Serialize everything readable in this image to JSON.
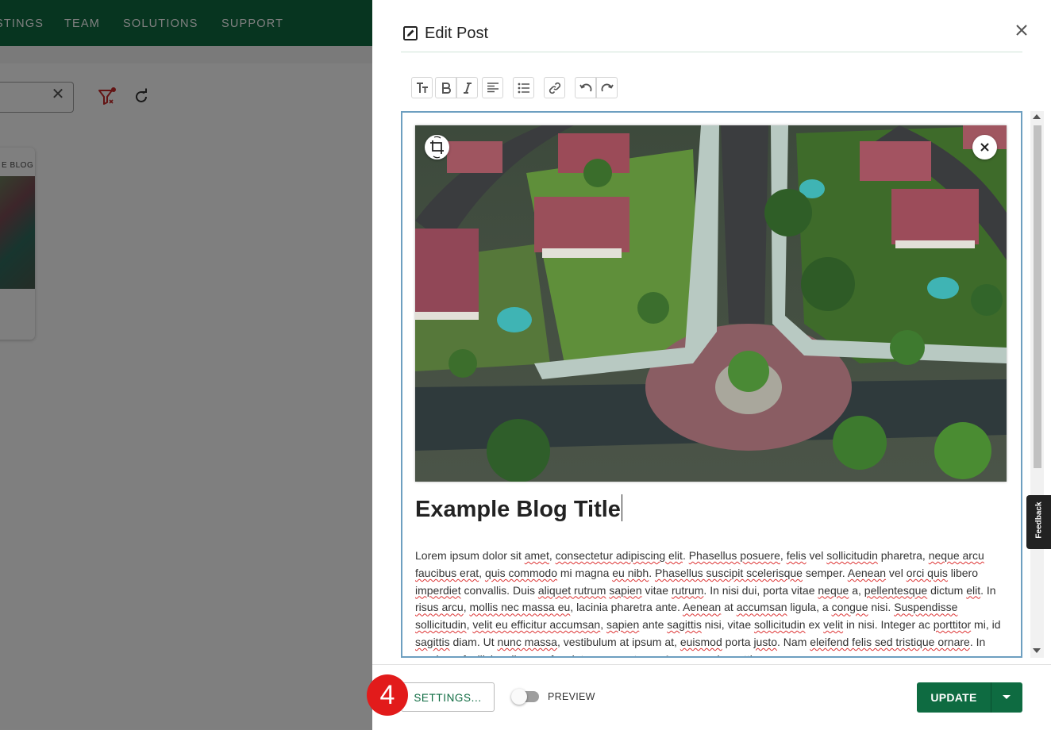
{
  "background_page": {
    "nav_items": [
      "STINGS",
      "TEAM",
      "SOLUTIONS",
      "SUPPORT"
    ],
    "post_card_label": "E BLOG"
  },
  "drawer": {
    "title": "Edit Post",
    "toolbar": {
      "icons": [
        "text-size-icon",
        "bold-icon",
        "italic-icon",
        "align-left-icon",
        "bullet-list-icon",
        "link-icon",
        "undo-icon",
        "redo-icon"
      ]
    },
    "post": {
      "title": "Example Blog Title",
      "body_segments": [
        {
          "t": "Lorem ipsum dolor sit ",
          "sp": false
        },
        {
          "t": "amet",
          "sp": true
        },
        {
          "t": ", ",
          "sp": false
        },
        {
          "t": "consectetur adipiscing elit",
          "sp": true
        },
        {
          "t": ". ",
          "sp": false
        },
        {
          "t": "Phasellus posuere",
          "sp": true
        },
        {
          "t": ", ",
          "sp": false
        },
        {
          "t": "felis",
          "sp": true
        },
        {
          "t": " vel ",
          "sp": false
        },
        {
          "t": "sollicitudin",
          "sp": true
        },
        {
          "t": " pharetra, ",
          "sp": false
        },
        {
          "t": "neque arcu faucibus erat",
          "sp": true
        },
        {
          "t": ", ",
          "sp": false
        },
        {
          "t": "quis commodo",
          "sp": true
        },
        {
          "t": " mi magna ",
          "sp": false
        },
        {
          "t": "eu nibh",
          "sp": true
        },
        {
          "t": ". ",
          "sp": false
        },
        {
          "t": "Phasellus suscipit scelerisque",
          "sp": true
        },
        {
          "t": " semper. ",
          "sp": false
        },
        {
          "t": "Aenean",
          "sp": true
        },
        {
          "t": " vel ",
          "sp": false
        },
        {
          "t": "orci quis",
          "sp": true
        },
        {
          "t": " libero ",
          "sp": false
        },
        {
          "t": "imperdiet",
          "sp": true
        },
        {
          "t": " convallis. Duis ",
          "sp": false
        },
        {
          "t": "aliquet rutrum",
          "sp": true
        },
        {
          "t": " ",
          "sp": false
        },
        {
          "t": "sapien",
          "sp": true
        },
        {
          "t": " vitae ",
          "sp": false
        },
        {
          "t": "rutrum",
          "sp": true
        },
        {
          "t": ". In nisi dui, porta vitae ",
          "sp": false
        },
        {
          "t": "neque",
          "sp": true
        },
        {
          "t": " a, ",
          "sp": false
        },
        {
          "t": "pellentesque",
          "sp": true
        },
        {
          "t": " dictum ",
          "sp": false
        },
        {
          "t": "elit",
          "sp": true
        },
        {
          "t": ". In ",
          "sp": false
        },
        {
          "t": "risus arcu",
          "sp": true
        },
        {
          "t": ", ",
          "sp": false
        },
        {
          "t": "mollis nec massa eu",
          "sp": true
        },
        {
          "t": ", lacinia pharetra ante. ",
          "sp": false
        },
        {
          "t": "Aenean",
          "sp": true
        },
        {
          "t": " at ",
          "sp": false
        },
        {
          "t": "accumsan",
          "sp": true
        },
        {
          "t": " ligula, a ",
          "sp": false
        },
        {
          "t": "congue",
          "sp": true
        },
        {
          "t": " nisi. ",
          "sp": false
        },
        {
          "t": "Suspendisse sollicitudin",
          "sp": true
        },
        {
          "t": ", ",
          "sp": false
        },
        {
          "t": "velit eu efficitur accumsan",
          "sp": true
        },
        {
          "t": ", ",
          "sp": false
        },
        {
          "t": "sapien",
          "sp": true
        },
        {
          "t": " ante ",
          "sp": false
        },
        {
          "t": "sagittis",
          "sp": true
        },
        {
          "t": " nisi, vitae ",
          "sp": false
        },
        {
          "t": "sollicitudin",
          "sp": true
        },
        {
          "t": " ex ",
          "sp": false
        },
        {
          "t": "velit",
          "sp": true
        },
        {
          "t": " in nisi. Integer ac ",
          "sp": false
        },
        {
          "t": "porttitor",
          "sp": true
        },
        {
          "t": " mi, id ",
          "sp": false
        },
        {
          "t": "sagittis",
          "sp": true
        },
        {
          "t": " diam. Ut ",
          "sp": false
        },
        {
          "t": "nunc massa",
          "sp": true
        },
        {
          "t": ", vestibulum at ipsum at, ",
          "sp": false
        },
        {
          "t": "euismod",
          "sp": true
        },
        {
          "t": " porta ",
          "sp": false
        },
        {
          "t": "justo",
          "sp": true
        },
        {
          "t": ". Nam ",
          "sp": false
        },
        {
          "t": "eleifend felis sed tristique ornare",
          "sp": true
        },
        {
          "t": ". In maximus facilisis odio, non feugiat purus porta ac. Aenean quis mattis arcu.",
          "sp": false
        }
      ]
    },
    "feedback_label": "Feedback",
    "footer": {
      "settings_label": "SETTINGS...",
      "step_number": "4",
      "preview_label": "PREVIEW",
      "preview_on": false,
      "update_label": "UPDATE"
    }
  },
  "colors": {
    "brand_green": "#0e6b41",
    "step_badge_red": "#e21b1b",
    "editor_border": "#6d9fc0"
  }
}
